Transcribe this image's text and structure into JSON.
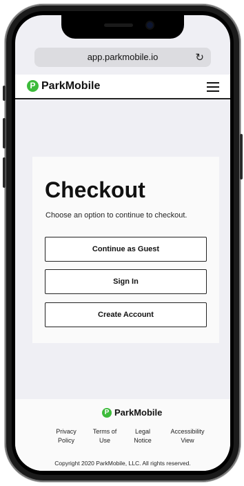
{
  "browser": {
    "url": "app.parkmobile.io",
    "reload_icon": "reload-icon"
  },
  "app": {
    "brand": "ParkMobile",
    "logo_letter": "P",
    "brand_color": "#3dbb3b",
    "menu_icon": "hamburger-icon"
  },
  "checkout": {
    "title": "Checkout",
    "subtitle": "Choose an option to continue to checkout.",
    "options": [
      "Continue as Guest",
      "Sign In",
      "Create Account"
    ]
  },
  "footer": {
    "brand": "ParkMobile",
    "links": [
      {
        "line1": "Privacy",
        "line2": "Policy"
      },
      {
        "line1": "Terms of",
        "line2": "Use"
      },
      {
        "line1": "Legal",
        "line2": "Notice"
      },
      {
        "line1": "Accessibility",
        "line2": "View"
      }
    ],
    "copyright": "Copyright 2020 ParkMobile, LLC. All rights reserved."
  }
}
